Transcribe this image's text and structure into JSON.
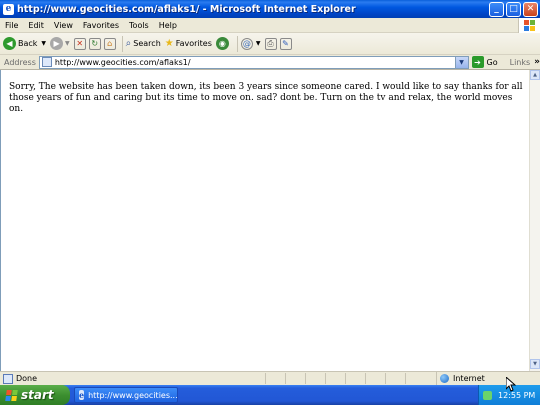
{
  "window": {
    "title": "http://www.geocities.com/aflaks1/ - Microsoft Internet Explorer",
    "min": "_",
    "max": "□",
    "close": "✕"
  },
  "menu": [
    "File",
    "Edit",
    "View",
    "Favorites",
    "Tools",
    "Help"
  ],
  "toolbar": {
    "back": "Back",
    "search": "Search",
    "favorites": "Favorites"
  },
  "address": {
    "label": "Address",
    "url": "http://www.geocities.com/aflaks1/",
    "go": "Go",
    "links": "Links",
    "links_more": "»"
  },
  "page": {
    "message": "Sorry, The website has been taken down, its been 3 years since someone cared. I would like to say thanks for all those years of fun and caring but its time to move on. sad? dont be. Turn on the tv and relax, the world moves on."
  },
  "status": {
    "text": "Done",
    "zone": "Internet"
  },
  "taskbar": {
    "start": "start",
    "task": "http://www.geocities...",
    "clock": "12:55 PM"
  },
  "colors": {
    "titlebar": "#0058E0",
    "taskbar": "#245DDB",
    "start": "#3C8F30"
  }
}
